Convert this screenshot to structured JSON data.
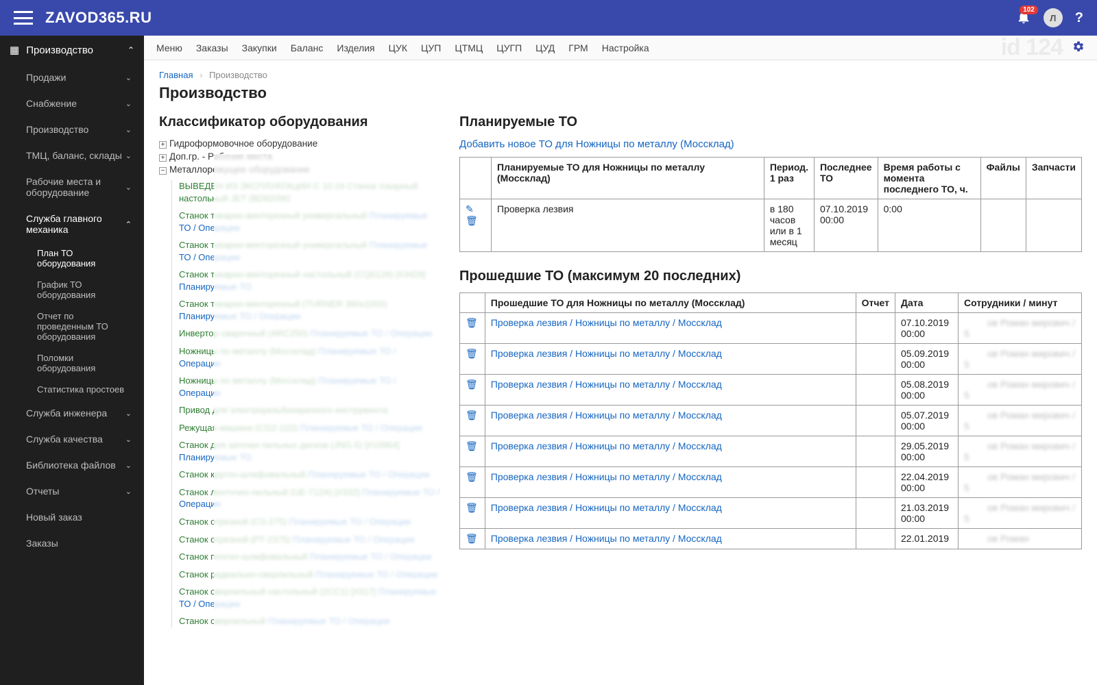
{
  "topbar": {
    "brand": "ZAVOD365.RU",
    "badge_count": "102",
    "avatar_letter": "Л"
  },
  "sidebar": {
    "head": "Производство",
    "items": [
      {
        "label": "Продажи"
      },
      {
        "label": "Снабжение"
      },
      {
        "label": "Производство"
      },
      {
        "label": "ТМЦ, баланс, склады"
      },
      {
        "label": "Рабочие места и оборудование"
      },
      {
        "label": "Служба главного механика",
        "open": true
      },
      {
        "label": "Служба инженера"
      },
      {
        "label": "Служба качества"
      },
      {
        "label": "Библиотека файлов"
      },
      {
        "label": "Отчеты"
      },
      {
        "label": "Новый заказ",
        "nochev": true
      },
      {
        "label": "Заказы",
        "nochev": true
      }
    ],
    "subs": [
      {
        "label": "План ТО оборудования",
        "active": true
      },
      {
        "label": "График ТО оборудования"
      },
      {
        "label": "Отчет по проведенным ТО оборудования"
      },
      {
        "label": "Поломки оборудования"
      },
      {
        "label": "Статистика простоев"
      }
    ]
  },
  "topmenu": {
    "items": [
      "Меню",
      "Заказы",
      "Закупки",
      "Баланс",
      "Изделия",
      "ЦУК",
      "ЦУП",
      "ЦТМЦ",
      "ЦУГП",
      "ЦУД",
      "ГРМ",
      "Настройка"
    ],
    "watermark": "id 124"
  },
  "breadcrumb": {
    "home": "Главная",
    "current": "Производство"
  },
  "page_title": "Производство",
  "classifier": {
    "title": "Классификатор оборудования",
    "top": [
      {
        "tog": "+",
        "label": "Гидроформовочное оборудование"
      },
      {
        "tog": "+",
        "label": "Доп.гр. - Рабочие места"
      },
      {
        "tog": "−",
        "label": "Металлорежущее оборудование"
      }
    ],
    "leaves": [
      {
        "name": "ВЫВЕДЕН ИЗ ЭКСПЛУАТАЦИИ С 10.19 Станок токарный настольный JET (BD920W)",
        "extra": ""
      },
      {
        "name": "Станок токарно-винторезный универсальный",
        "extra": "Планируемые ТО / Операции"
      },
      {
        "name": "Станок токарно-винторезный универсальный",
        "extra": "Планируемые ТО / Операции"
      },
      {
        "name": "Станок токарно-винторезный настольный (CQ6128) [#3429]",
        "extra": "Планируемые ТО"
      },
      {
        "name": "Станок токарно-винторезный (TURNER 360x1000)",
        "extra": "Планируемые ТО / Операции"
      },
      {
        "name": "Инвертор сварочный (ARC250)",
        "extra": "Планируемые ТО / Операции"
      },
      {
        "name": "Ножницы по металлу (Моссклад)",
        "extra": "Планируемые ТО / Операции"
      },
      {
        "name": "Ножницы по металлу (Моссклад)",
        "extra": "Планируемые ТО / Операции"
      },
      {
        "name": "Привод для электрорезьбонарезного инструмента",
        "extra": ""
      },
      {
        "name": "Режущая машина (CG2-11D)",
        "extra": "Планируемые ТО / Операции"
      },
      {
        "name": "Станок для заточки пильных дисков (JNG-5) [#10964]",
        "extra": "Планируемые ТО"
      },
      {
        "name": "Станок кругло-шлифовальный",
        "extra": "Планируемые ТО / Операции"
      },
      {
        "name": "Станок ленточно-пильный (UE-712A) [#332]",
        "extra": "Планируемые ТО / Операции"
      },
      {
        "name": "Станок отрезной (CS-275)",
        "extra": "Планируемые ТО / Операции"
      },
      {
        "name": "Станок отрезной (РТ-2375)",
        "extra": "Планируемые ТО / Операции"
      },
      {
        "name": "Станок плоско-шлифовальный",
        "extra": "Планируемые ТО / Операции"
      },
      {
        "name": "Станок радиально-сверлильный",
        "extra": "Планируемые ТО / Операции"
      },
      {
        "name": "Станок сверлильный настольный (2СС1) [#317]",
        "extra": "Планируемые ТО / Операции"
      },
      {
        "name": "Станок сверлильный",
        "extra": "Планируемые ТО / Операции"
      }
    ]
  },
  "planned": {
    "title": "Планируемые ТО",
    "add_link": "Добавить новое ТО для Ножницы по металлу (Моссклад)",
    "headers": {
      "c0": "",
      "c1": "Планируемые ТО для Ножницы по металлу (Моссклад)",
      "c2": "Период. 1 раз",
      "c3": "Последнее ТО",
      "c4": "Время работы с момента последнего ТО, ч.",
      "c5": "Файлы",
      "c6": "Запчасти"
    },
    "row": {
      "name": "Проверка лезвия",
      "period": "в 180 часов или в 1 месяц",
      "last": "07.10.2019 00:00",
      "hours": "0:00"
    }
  },
  "past": {
    "title": "Прошедшие ТО (максимум 20 последних)",
    "headers": {
      "c0": "",
      "c1": "Прошедшие ТО для Ножницы по металлу (Моссклад)",
      "c2": "Отчет",
      "c3": "Дата",
      "c4": "Сотрудники / минут"
    },
    "rows": [
      {
        "name": "Проверка лезвия / Ножницы по металлу / Моссклад",
        "date": "07.10.2019 00:00",
        "emp": "ов Роман мирович / 5"
      },
      {
        "name": "Проверка лезвия / Ножницы по металлу / Моссклад",
        "date": "05.09.2019 00:00",
        "emp": "ов Роман мирович / 5"
      },
      {
        "name": "Проверка лезвия / Ножницы по металлу / Моссклад",
        "date": "05.08.2019 00:00",
        "emp": "ов Роман мирович / 5"
      },
      {
        "name": "Проверка лезвия / Ножницы по металлу / Моссклад",
        "date": "05.07.2019 00:00",
        "emp": "ов Роман мирович / 5"
      },
      {
        "name": "Проверка лезвия / Ножницы по металлу / Моссклад",
        "date": "29.05.2019 00:00",
        "emp": "ов Роман мирович / 5"
      },
      {
        "name": "Проверка лезвия / Ножницы по металлу / Моссклад",
        "date": "22.04.2019 00:00",
        "emp": "ов Роман мирович / 5"
      },
      {
        "name": "Проверка лезвия / Ножницы по металлу / Моссклад",
        "date": "21.03.2019 00:00",
        "emp": "ов Роман мирович / 5"
      },
      {
        "name": "Проверка лезвия / Ножницы по металлу / Моссклад",
        "date": "22.01.2019",
        "emp": "ов Роман"
      }
    ]
  }
}
